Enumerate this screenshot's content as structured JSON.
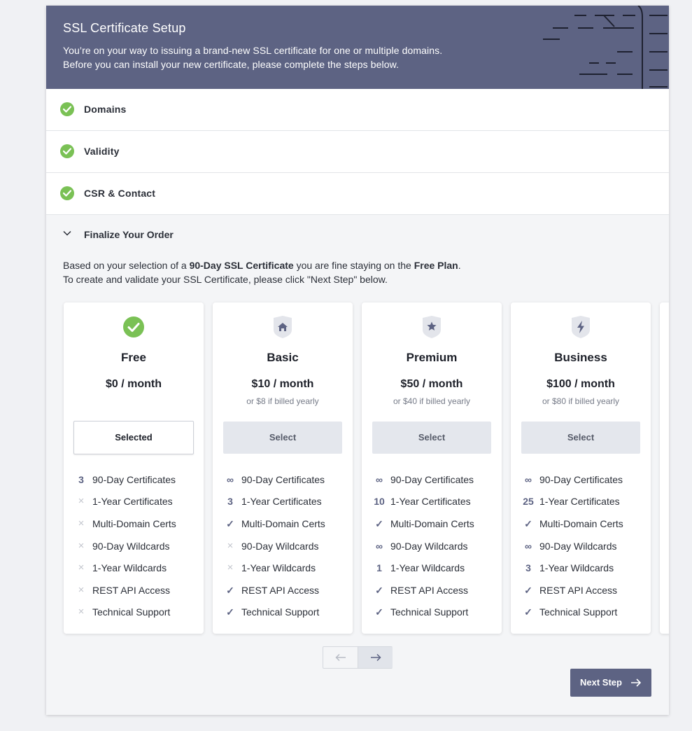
{
  "header": {
    "title": "SSL Certificate Setup",
    "subtitle_line1": "You’re on your way to issuing a brand-new SSL certificate for one or multiple domains.",
    "subtitle_line2": "Before you can install your new certificate, please complete the steps below."
  },
  "steps": [
    {
      "label": "Domains",
      "status": "complete"
    },
    {
      "label": "Validity",
      "status": "complete"
    },
    {
      "label": "CSR & Contact",
      "status": "complete"
    }
  ],
  "finalize": {
    "label": "Finalize Your Order",
    "desc_prefix": "Based on your selection of a ",
    "desc_bold1": "90-Day SSL Certificate",
    "desc_mid": " you are fine staying on the ",
    "desc_bold2": "Free Plan",
    "desc_suffix": ".",
    "desc_line2": "To create and validate your SSL Certificate, please click \"Next Step\" below."
  },
  "plans": [
    {
      "name": "Free",
      "price": "$0 / month",
      "yearly": "",
      "button": "Selected",
      "icon": "check-circle-icon",
      "features": [
        {
          "mark": "3",
          "label": "90-Day Certificates"
        },
        {
          "mark": "×",
          "label": "1-Year Certificates"
        },
        {
          "mark": "×",
          "label": "Multi-Domain Certs"
        },
        {
          "mark": "×",
          "label": "90-Day Wildcards"
        },
        {
          "mark": "×",
          "label": "1-Year Wildcards"
        },
        {
          "mark": "×",
          "label": "REST API Access"
        },
        {
          "mark": "×",
          "label": "Technical Support"
        }
      ]
    },
    {
      "name": "Basic",
      "price": "$10 / month",
      "yearly": "or $8 if billed yearly",
      "button": "Select",
      "icon": "home-shield-icon",
      "features": [
        {
          "mark": "∞",
          "label": "90-Day Certificates"
        },
        {
          "mark": "3",
          "label": "1-Year Certificates"
        },
        {
          "mark": "✓",
          "label": "Multi-Domain Certs"
        },
        {
          "mark": "×",
          "label": "90-Day Wildcards"
        },
        {
          "mark": "×",
          "label": "1-Year Wildcards"
        },
        {
          "mark": "✓",
          "label": "REST API Access"
        },
        {
          "mark": "✓",
          "label": "Technical Support"
        }
      ]
    },
    {
      "name": "Premium",
      "price": "$50 / month",
      "yearly": "or $40 if billed yearly",
      "button": "Select",
      "icon": "star-shield-icon",
      "features": [
        {
          "mark": "∞",
          "label": "90-Day Certificates"
        },
        {
          "mark": "10",
          "label": "1-Year Certificates"
        },
        {
          "mark": "✓",
          "label": "Multi-Domain Certs"
        },
        {
          "mark": "∞",
          "label": "90-Day Wildcards"
        },
        {
          "mark": "1",
          "label": "1-Year Wildcards"
        },
        {
          "mark": "✓",
          "label": "REST API Access"
        },
        {
          "mark": "✓",
          "label": "Technical Support"
        }
      ]
    },
    {
      "name": "Business",
      "price": "$100 / month",
      "yearly": "or $80 if billed yearly",
      "button": "Select",
      "icon": "bolt-shield-icon",
      "features": [
        {
          "mark": "∞",
          "label": "90-Day Certificates"
        },
        {
          "mark": "25",
          "label": "1-Year Certificates"
        },
        {
          "mark": "✓",
          "label": "Multi-Domain Certs"
        },
        {
          "mark": "∞",
          "label": "90-Day Wildcards"
        },
        {
          "mark": "3",
          "label": "1-Year Wildcards"
        },
        {
          "mark": "✓",
          "label": "REST API Access"
        },
        {
          "mark": "✓",
          "label": "Technical Support"
        }
      ]
    }
  ],
  "pager": {
    "prev": "←",
    "next": "→"
  },
  "next_step": {
    "label": "Next Step"
  },
  "colors": {
    "header": "#5d6383",
    "check": "#7ac155",
    "accent": "#5d6383"
  }
}
